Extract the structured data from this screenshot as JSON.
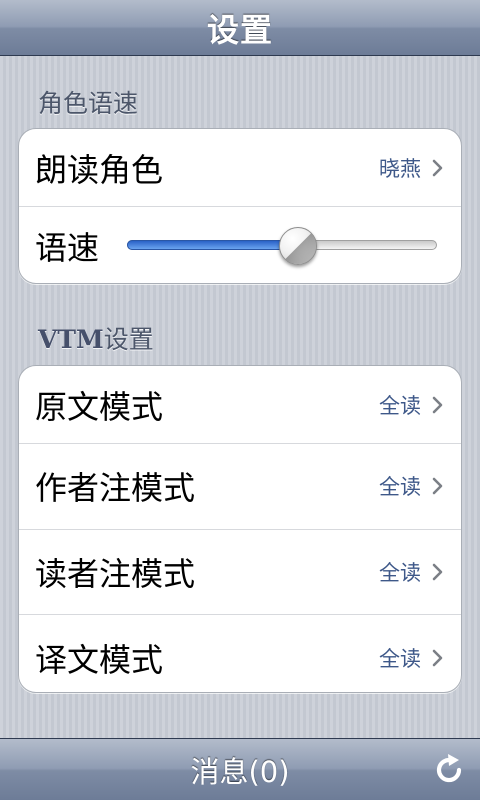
{
  "header": {
    "title": "设置"
  },
  "sections": {
    "voice": {
      "header": "角色语速",
      "role": {
        "label": "朗读角色",
        "value": "晓燕"
      },
      "speed": {
        "label": "语速",
        "level_percent": 55
      }
    },
    "vtm": {
      "header_strong": "VTM",
      "header_rest": "设置",
      "rows": [
        {
          "label": "原文模式",
          "value": "全读"
        },
        {
          "label": "作者注模式",
          "value": "全读"
        },
        {
          "label": "读者注模式",
          "value": "全读"
        },
        {
          "label": "译文模式",
          "value": "全读"
        }
      ]
    }
  },
  "footer": {
    "message_label": "消息(0)"
  },
  "icons": {
    "chevron": "chevron-right-icon",
    "refresh": "refresh-icon"
  },
  "colors": {
    "value_text": "#3e5889",
    "slider_fill": "#2a62c7"
  }
}
